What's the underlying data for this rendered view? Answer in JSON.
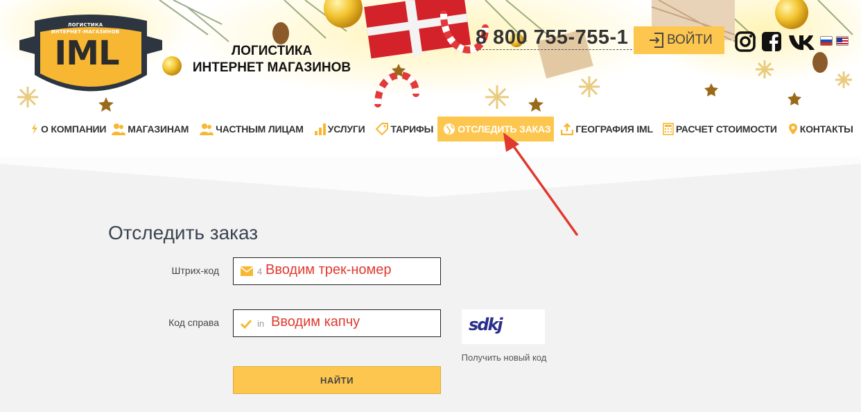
{
  "header": {
    "logo_top_line1": "ЛОГИСТИКА",
    "logo_top_line2": "ИНТЕРНЕТ-МАГАЗИНОВ",
    "logo_main": "IML",
    "tagline_line1": "ЛОГИСТИКА",
    "tagline_line2": "ИНТЕРНЕТ МАГАЗИНОВ",
    "phone": "8 800 755-755-1",
    "login_label": "ВОЙТИ",
    "social": [
      "instagram-icon",
      "facebook-icon",
      "vk-icon"
    ],
    "flags": [
      "russian-flag-icon",
      "us-flag-icon"
    ],
    "accent_color": "#fdc64e"
  },
  "nav": {
    "items": [
      {
        "label": "О КОМПАНИИ",
        "icon": "tag-icon"
      },
      {
        "label": "МАГАЗИНАМ",
        "icon": "people-icon"
      },
      {
        "label": "ЧАСТНЫМ ЛИЦАМ",
        "icon": "people-icon"
      },
      {
        "label": "УСЛУГИ",
        "icon": "bars-icon"
      },
      {
        "label": "ТАРИФЫ",
        "icon": "tag-icon"
      },
      {
        "label": "ОТСЛЕДИТЬ ЗАКАЗ",
        "icon": "globe-icon",
        "active": true
      },
      {
        "label": "ГЕОГРАФИЯ IML",
        "icon": "upload-icon"
      },
      {
        "label": "РАСЧЕТ СТОИМОСТИ",
        "icon": "calculator-icon"
      },
      {
        "label": "КОНТАКТЫ",
        "icon": "pin-icon"
      }
    ]
  },
  "form": {
    "title": "Отследить заказ",
    "barcode_label": "Штрих-код",
    "barcode_ghost": "4",
    "barcode_overlay": "Вводим трек-номер",
    "code_label": "Код справа",
    "code_ghost": "in",
    "code_overlay": "Вводим капчу",
    "captcha_text": "sdkj",
    "new_code_label": "Получить новый код",
    "submit_label": "НАЙТИ"
  },
  "annotation": {
    "arrow_color": "#e0392e"
  }
}
